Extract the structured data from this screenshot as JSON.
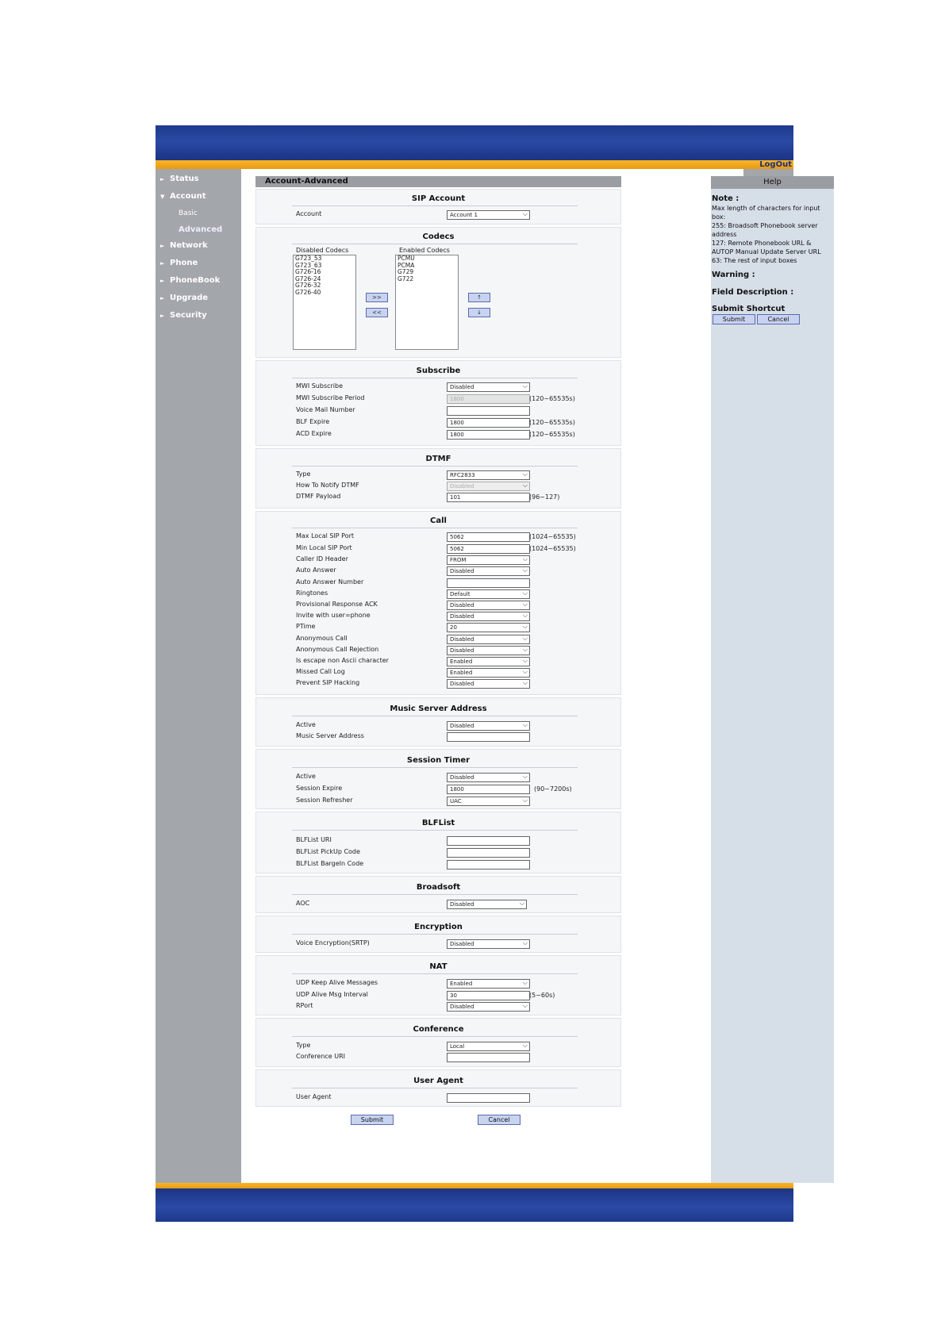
{
  "header": {
    "logout": "LogOut"
  },
  "nav": {
    "status": "Status",
    "account": "Account",
    "basic": "Basic",
    "advanced": "Advanced",
    "network": "Network",
    "phone": "Phone",
    "phonebook": "PhoneBook",
    "upgrade": "Upgrade",
    "security": "Security"
  },
  "page": {
    "title": "Account-Advanced"
  },
  "sip_account": {
    "title": "SIP Account",
    "account_label": "Account",
    "account_value": "Account 1"
  },
  "codecs": {
    "title": "Codecs",
    "disabled_label": "Disabled Codecs",
    "enabled_label": "Enabled Codecs",
    "disabled": [
      "G723_53",
      "G723_63",
      "G726-16",
      "G726-24",
      "G726-32",
      "G726-40"
    ],
    "enabled": [
      "PCMU",
      "PCMA",
      "G729",
      "G722"
    ],
    "add": ">>",
    "remove": "<<",
    "up": "↑",
    "down": "↓"
  },
  "subscribe": {
    "title": "Subscribe",
    "mwi_label": "MWI Subscribe",
    "mwi_value": "Disabled",
    "period_label": "MWI Subscribe Period",
    "period_value": "1800",
    "period_range": "(120~65535s)",
    "voicemail_label": "Voice Mail Number",
    "voicemail_value": "",
    "blf_label": "BLF Expire",
    "blf_value": "1800",
    "blf_range": "(120~65535s)",
    "acd_label": "ACD Expire",
    "acd_value": "1800",
    "acd_range": "(120~65535s)"
  },
  "dtmf": {
    "title": "DTMF",
    "type_label": "Type",
    "type_value": "RFC2833",
    "notify_label": "How To Notify DTMF",
    "notify_value": "Disabled",
    "payload_label": "DTMF Payload",
    "payload_value": "101",
    "payload_range": "(96~127)"
  },
  "call": {
    "title": "Call",
    "max_port_label": "Max Local SIP Port",
    "max_port_value": "5062",
    "max_port_range": "(1024~65535)",
    "min_port_label": "Min Local SIP Port",
    "min_port_value": "5062",
    "min_port_range": "(1024~65535)",
    "caller_id_label": "Caller ID Header",
    "caller_id_value": "FROM",
    "auto_answer_label": "Auto Answer",
    "auto_answer_value": "Disabled",
    "auto_answer_num_label": "Auto Answer Number",
    "auto_answer_num_value": "",
    "ringtones_label": "Ringtones",
    "ringtones_value": "Default",
    "prov_ack_label": "Provisional Response ACK",
    "prov_ack_value": "Disabled",
    "invite_label": "Invite with user=phone",
    "invite_value": "Disabled",
    "ptime_label": "PTime",
    "ptime_value": "20",
    "anon_call_label": "Anonymous Call",
    "anon_call_value": "Disabled",
    "anon_rej_label": "Anonymous Call Rejection",
    "anon_rej_value": "Disabled",
    "escape_label": "Is escape non Ascii character",
    "escape_value": "Enabled",
    "missed_label": "Missed Call Log",
    "missed_value": "Enabled",
    "prevent_label": "Prevent SIP Hacking",
    "prevent_value": "Disabled"
  },
  "music": {
    "title": "Music Server Address",
    "active_label": "Active",
    "active_value": "Disabled",
    "address_label": "Music Server Address",
    "address_value": ""
  },
  "session": {
    "title": "Session Timer",
    "active_label": "Active",
    "active_value": "Disabled",
    "expire_label": "Session Expire",
    "expire_value": "1800",
    "expire_range": "(90~7200s)",
    "refresher_label": "Session Refresher",
    "refresher_value": "UAC"
  },
  "blflist": {
    "title": "BLFList",
    "uri_label": "BLFList URI",
    "pickup_label": "BLFList PickUp Code",
    "bargein_label": "BLFList BargeIn Code"
  },
  "broadsoft": {
    "title": "Broadsoft",
    "aoc_label": "AOC",
    "aoc_value": "Disabled"
  },
  "encryption": {
    "title": "Encryption",
    "srtp_label": "Voice Encryption(SRTP)",
    "srtp_value": "Disabled"
  },
  "nat": {
    "title": "NAT",
    "keepalive_label": "UDP Keep Alive Messages",
    "keepalive_value": "Enabled",
    "interval_label": "UDP Alive Msg Interval",
    "interval_value": "30",
    "interval_range": "(5~60s)",
    "rport_label": "RPort",
    "rport_value": "Disabled"
  },
  "conference": {
    "title": "Conference",
    "type_label": "Type",
    "type_value": "Local",
    "uri_label": "Conference URI"
  },
  "user_agent": {
    "title": "User Agent",
    "label": "User Agent",
    "value": ""
  },
  "actions": {
    "submit": "Submit",
    "cancel": "Cancel"
  },
  "help": {
    "title": "Help",
    "note_title": "Note :",
    "note_lines": [
      "Max length of characters for input box:",
      "255: Broadsoft Phonebook server address",
      "127: Remote Phonebook URL & AUTOP Manual Update Server URL",
      "63: The rest of input boxes"
    ],
    "warning_title": "Warning :",
    "field_desc_title": "Field Description :",
    "shortcut_title": "Submit Shortcut",
    "submit": "Submit",
    "cancel": "Cancel"
  }
}
